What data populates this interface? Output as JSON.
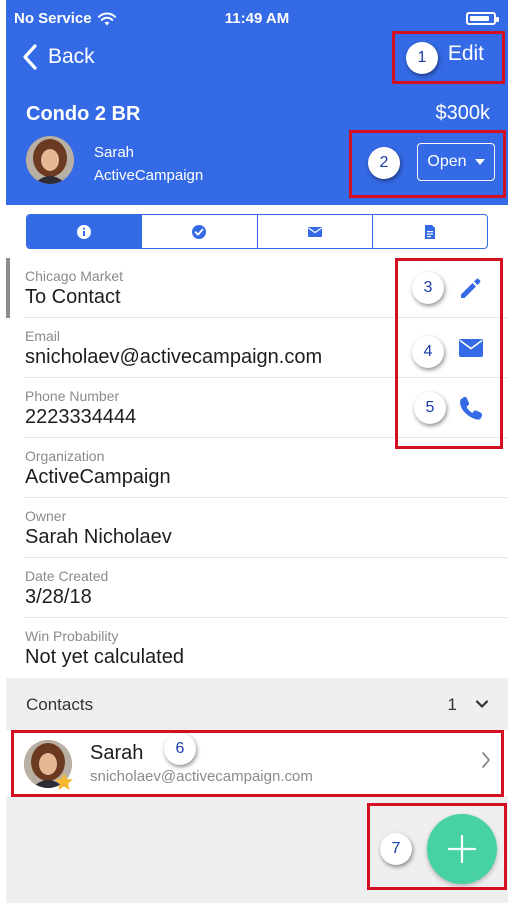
{
  "status_bar": {
    "carrier": "No Service",
    "time": "11:49 AM",
    "battery_level": 0.85
  },
  "nav": {
    "back_label": "Back",
    "edit_label": "Edit"
  },
  "deal": {
    "title": "Condo 2 BR",
    "value": "$300k",
    "owner_first": "Sarah",
    "owner_last": "ActiveCampaign",
    "status": "Open"
  },
  "tabs": [
    {
      "icon": "info-icon",
      "active": true
    },
    {
      "icon": "check-circle-icon",
      "active": false
    },
    {
      "icon": "envelope-icon",
      "active": false
    },
    {
      "icon": "document-icon",
      "active": false
    }
  ],
  "fields": [
    {
      "label": "Chicago Market",
      "value": "To Contact"
    },
    {
      "label": "Email",
      "value": "snicholaev@activecampaign.com"
    },
    {
      "label": "Phone Number",
      "value": "2223334444"
    },
    {
      "label": "Organization",
      "value": "ActiveCampaign"
    },
    {
      "label": "Owner",
      "value": "Sarah Nicholaev"
    },
    {
      "label": "Date Created",
      "value": "3/28/18"
    },
    {
      "label": "Win Probability",
      "value": "Not yet calculated"
    }
  ],
  "contacts": {
    "title": "Contacts",
    "count": "1",
    "items": [
      {
        "name": "Sarah",
        "email": "snicholaev@activecampaign.com"
      }
    ]
  },
  "annotations": [
    "1",
    "2",
    "3",
    "4",
    "5",
    "6",
    "7"
  ],
  "colors": {
    "primary": "#356ae6",
    "fab": "#46d3a1",
    "annotation": "#d40f22",
    "star": "#f5b82e"
  }
}
